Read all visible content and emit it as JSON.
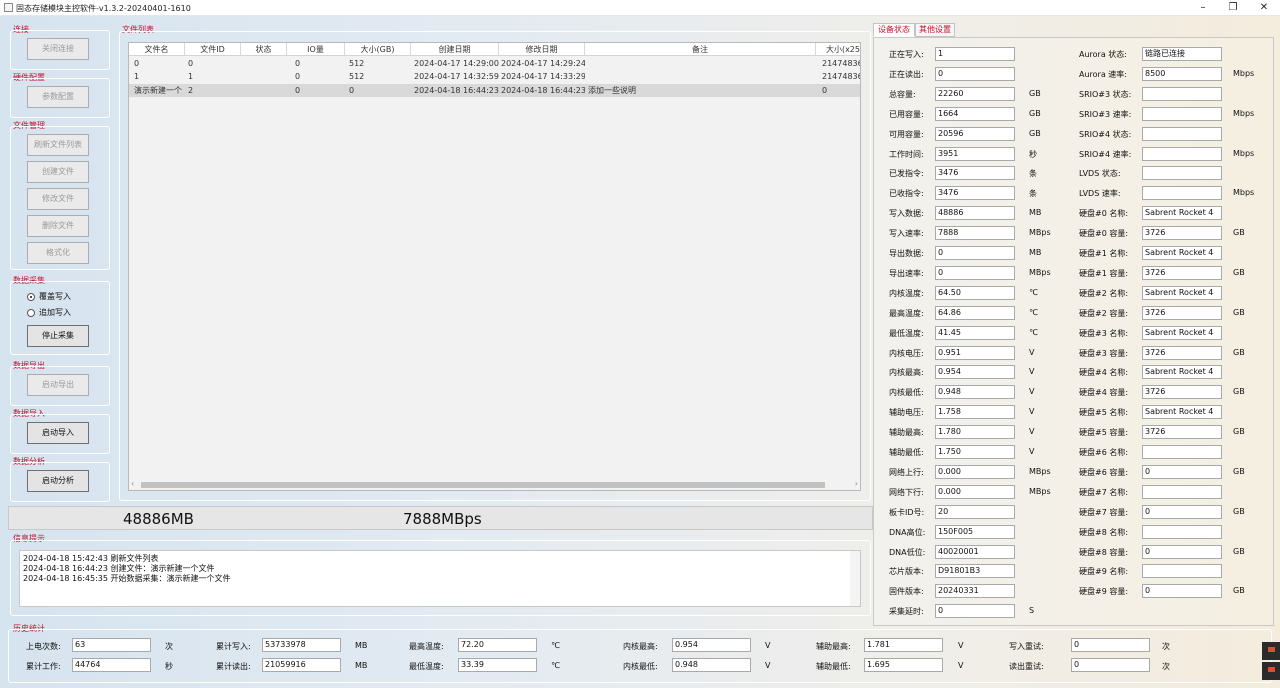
{
  "window": {
    "title": "固态存储模块主控软件-v1.3.2-20240401-1610"
  },
  "left": {
    "conn": {
      "title": "连接",
      "close_btn": "关闭连接"
    },
    "hw": {
      "title": "硬件配置",
      "param_btn": "参数配置"
    },
    "file": {
      "title": "文件管理",
      "refresh_btn": "刷新文件列表",
      "create_btn": "创建文件",
      "modify_btn": "修改文件",
      "delete_btn": "删除文件",
      "format_btn": "格式化"
    },
    "acq": {
      "title": "数据采集",
      "overwrite": "覆盖写入",
      "append": "追加写入",
      "stop_btn": "停止采集"
    },
    "export": {
      "title": "数据导出",
      "start_btn": "启动导出"
    },
    "import": {
      "title": "数据导入",
      "start_btn": "启动导入"
    },
    "analysis": {
      "title": "数据分析",
      "start_btn": "启动分析"
    }
  },
  "filelist": {
    "title": "文件列表",
    "columns": [
      "文件名",
      "文件ID",
      "状态",
      "IO量",
      "大小(GB)",
      "创建日期",
      "修改日期",
      "备注",
      "大小(x25"
    ],
    "rows": [
      [
        "0",
        "0",
        "",
        "0",
        "512",
        "2024-04-17 14:29:00",
        "2024-04-17 14:29:24",
        "",
        "21474836"
      ],
      [
        "1",
        "1",
        "",
        "0",
        "512",
        "2024-04-17 14:32:59",
        "2024-04-17 14:33:29",
        "",
        "21474836"
      ],
      [
        "演示新建一个",
        "2",
        "",
        "0",
        "0",
        "2024-04-18 16:44:23",
        "2024-04-18 16:44:23",
        "添加一些说明",
        "0"
      ]
    ]
  },
  "status": {
    "written": "48886MB",
    "speed": "7888MBps"
  },
  "messages": {
    "title": "信息提示",
    "lines": [
      "2024-04-18 15:42:43 刷新文件列表",
      "2024-04-18 16:44:23 创建文件：演示新建一个文件",
      "2024-04-18 16:45:35 开始数据采集：演示新建一个文件"
    ]
  },
  "tabs": {
    "device": "设备状态",
    "other": "其他设置"
  },
  "device_left": [
    {
      "label": "正在写入:",
      "value": "1",
      "unit": ""
    },
    {
      "label": "正在读出:",
      "value": "0",
      "unit": ""
    },
    {
      "label": "总容量:",
      "value": "22260",
      "unit": "GB"
    },
    {
      "label": "已用容量:",
      "value": "1664",
      "unit": "GB"
    },
    {
      "label": "可用容量:",
      "value": "20596",
      "unit": "GB"
    },
    {
      "label": "工作时间:",
      "value": "3951",
      "unit": "秒"
    },
    {
      "label": "已发指令:",
      "value": "3476",
      "unit": "条"
    },
    {
      "label": "已收指令:",
      "value": "3476",
      "unit": "条"
    },
    {
      "label": "写入数据:",
      "value": "48886",
      "unit": "MB"
    },
    {
      "label": "写入速率:",
      "value": "7888",
      "unit": "MBps"
    },
    {
      "label": "导出数据:",
      "value": "0",
      "unit": "MB"
    },
    {
      "label": "导出速率:",
      "value": "0",
      "unit": "MBps"
    },
    {
      "label": "内核温度:",
      "value": "64.50",
      "unit": "℃"
    },
    {
      "label": "最高温度:",
      "value": "64.86",
      "unit": "℃"
    },
    {
      "label": "最低温度:",
      "value": "41.45",
      "unit": "℃"
    },
    {
      "label": "内核电压:",
      "value": "0.951",
      "unit": "V"
    },
    {
      "label": "内核最高:",
      "value": "0.954",
      "unit": "V"
    },
    {
      "label": "内核最低:",
      "value": "0.948",
      "unit": "V"
    },
    {
      "label": "辅助电压:",
      "value": "1.758",
      "unit": "V"
    },
    {
      "label": "辅助最高:",
      "value": "1.780",
      "unit": "V"
    },
    {
      "label": "辅助最低:",
      "value": "1.750",
      "unit": "V"
    },
    {
      "label": "网络上行:",
      "value": "0.000",
      "unit": "MBps"
    },
    {
      "label": "网络下行:",
      "value": "0.000",
      "unit": "MBps"
    },
    {
      "label": "板卡ID号:",
      "value": "20",
      "unit": ""
    },
    {
      "label": "DNA高位:",
      "value": "150F005",
      "unit": ""
    },
    {
      "label": "DNA低位:",
      "value": "40020001",
      "unit": ""
    },
    {
      "label": "芯片版本:",
      "value": "D91801B3",
      "unit": ""
    },
    {
      "label": "固件版本:",
      "value": "20240331",
      "unit": ""
    },
    {
      "label": "采集延时:",
      "value": "0",
      "unit": "S"
    }
  ],
  "device_right": [
    {
      "label": "Aurora 状态:",
      "value": "链路已连接",
      "unit": ""
    },
    {
      "label": "Aurora 速率:",
      "value": "8500",
      "unit": "Mbps"
    },
    {
      "label": "SRIO#3 状态:",
      "value": "",
      "unit": ""
    },
    {
      "label": "SRIO#3 速率:",
      "value": "",
      "unit": "Mbps"
    },
    {
      "label": "SRIO#4 状态:",
      "value": "",
      "unit": ""
    },
    {
      "label": "SRIO#4 速率:",
      "value": "",
      "unit": "Mbps"
    },
    {
      "label": "LVDS   状态:",
      "value": "",
      "unit": ""
    },
    {
      "label": "LVDS   速率:",
      "value": "",
      "unit": "Mbps"
    },
    {
      "label": "硬盘#0 名称:",
      "value": "Sabrent Rocket 4",
      "unit": ""
    },
    {
      "label": "硬盘#0 容量:",
      "value": "3726",
      "unit": "GB"
    },
    {
      "label": "硬盘#1 名称:",
      "value": "Sabrent Rocket 4",
      "unit": ""
    },
    {
      "label": "硬盘#1 容量:",
      "value": "3726",
      "unit": "GB"
    },
    {
      "label": "硬盘#2 名称:",
      "value": "Sabrent Rocket 4",
      "unit": ""
    },
    {
      "label": "硬盘#2 容量:",
      "value": "3726",
      "unit": "GB"
    },
    {
      "label": "硬盘#3 名称:",
      "value": "Sabrent Rocket 4",
      "unit": ""
    },
    {
      "label": "硬盘#3 容量:",
      "value": "3726",
      "unit": "GB"
    },
    {
      "label": "硬盘#4 名称:",
      "value": "Sabrent Rocket 4",
      "unit": ""
    },
    {
      "label": "硬盘#4 容量:",
      "value": "3726",
      "unit": "GB"
    },
    {
      "label": "硬盘#5 名称:",
      "value": "Sabrent Rocket 4",
      "unit": ""
    },
    {
      "label": "硬盘#5 容量:",
      "value": "3726",
      "unit": "GB"
    },
    {
      "label": "硬盘#6 名称:",
      "value": "",
      "unit": ""
    },
    {
      "label": "硬盘#6 容量:",
      "value": "0",
      "unit": "GB"
    },
    {
      "label": "硬盘#7 名称:",
      "value": "",
      "unit": ""
    },
    {
      "label": "硬盘#7 容量:",
      "value": "0",
      "unit": "GB"
    },
    {
      "label": "硬盘#8 名称:",
      "value": "",
      "unit": ""
    },
    {
      "label": "硬盘#8 容量:",
      "value": "0",
      "unit": "GB"
    },
    {
      "label": "硬盘#9 名称:",
      "value": "",
      "unit": ""
    },
    {
      "label": "硬盘#9 容量:",
      "value": "0",
      "unit": "GB"
    }
  ],
  "history": {
    "title": "历史统计",
    "items": [
      {
        "label": "上电次数:",
        "value": "63",
        "unit": "次"
      },
      {
        "label": "累计写入:",
        "value": "53733978",
        "unit": "MB"
      },
      {
        "label": "最高温度:",
        "value": "72.20",
        "unit": "℃"
      },
      {
        "label": "内核最高:",
        "value": "0.954",
        "unit": "V"
      },
      {
        "label": "辅助最高:",
        "value": "1.781",
        "unit": "V"
      },
      {
        "label": "写入重试:",
        "value": "0",
        "unit": "次"
      },
      {
        "label": "累计工作:",
        "value": "44764",
        "unit": "秒"
      },
      {
        "label": "累计读出:",
        "value": "21059916",
        "unit": "MB"
      },
      {
        "label": "最低温度:",
        "value": "33.39",
        "unit": "℃"
      },
      {
        "label": "内核最低:",
        "value": "0.948",
        "unit": "V"
      },
      {
        "label": "辅助最低:",
        "value": "1.695",
        "unit": "V"
      },
      {
        "label": "读出重试:",
        "value": "0",
        "unit": "次"
      }
    ]
  }
}
